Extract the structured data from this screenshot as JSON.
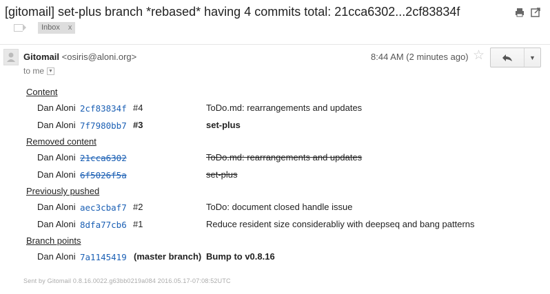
{
  "subject": "[gitomail] set-plus branch *rebased* having 4 commits total: 21cca6302...2cf83834f",
  "label_chip": {
    "name": "Inbox",
    "remove": "x"
  },
  "sender": {
    "name": "Gitomail",
    "email": "<osiris@aloni.org>"
  },
  "recipient_label": "to me",
  "time": "8:44 AM (2 minutes ago)",
  "icons": {
    "print": "print-icon",
    "new_window": "new-window-icon",
    "label": "label-icon",
    "avatar": "avatar-icon",
    "star": "star-icon",
    "reply": "reply-icon",
    "more": "chevron-down-icon"
  },
  "sections": {
    "content": "Content",
    "removed": "Removed content",
    "pushed": "Previously pushed",
    "branch_points": "Branch points"
  },
  "content_rows": [
    {
      "author": "Dan Aloni",
      "hash": "2cf83834f",
      "idx": "#4",
      "msg": "ToDo.md: rearrangements and updates"
    },
    {
      "author": "Dan Aloni",
      "hash": "7f7980bb7",
      "idx": "#3",
      "msg": "set-plus"
    }
  ],
  "removed_rows": [
    {
      "author": "Dan Aloni",
      "hash": "21cca6302",
      "msg": "ToDo.md: rearrangements and updates"
    },
    {
      "author": "Dan Aloni",
      "hash": "6f5026f5a",
      "msg": "set-plus"
    }
  ],
  "pushed_rows": [
    {
      "author": "Dan Aloni",
      "hash": "aec3cbaf7",
      "idx": "#2",
      "msg": "ToDo: document closed handle issue"
    },
    {
      "author": "Dan Aloni",
      "hash": "8dfa77cb6",
      "idx": "#1",
      "msg": "Reduce resident size considerabliy with deepseq and bang patterns"
    }
  ],
  "branch_rows": [
    {
      "author": "Dan Aloni",
      "hash": "7a1145419",
      "idx": "(master branch)",
      "msg": "Bump to v0.8.16"
    }
  ],
  "footer": "Sent by Gitomail 0.8.16.0022.g63bb0219a084 2016.05.17-07:08:52UTC",
  "colors": {
    "hash_link": "#1a5fb4",
    "chip_bg": "#dddddd"
  }
}
